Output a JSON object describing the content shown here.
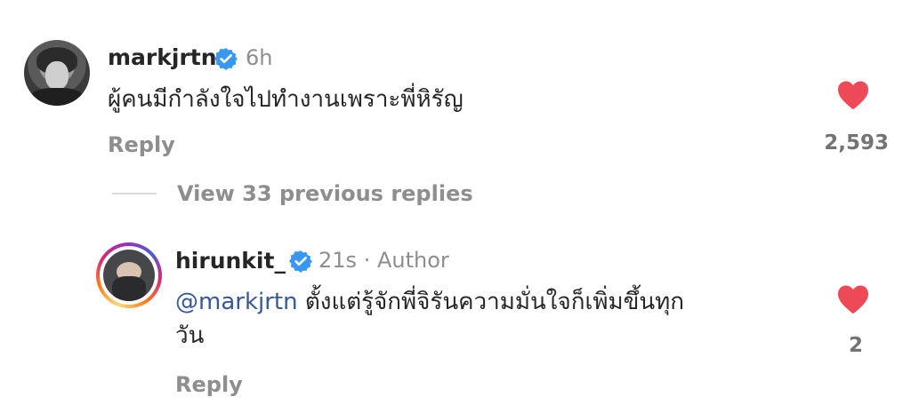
{
  "parent_comment": {
    "username": "markjrtn",
    "time": "6h",
    "text": "ผู้คนมีกำลังใจไปทำงานเพราะพี่หิรัญ",
    "reply_label": "Reply",
    "likes": "2,593",
    "like_icon": "heart-icon",
    "heart_color": "#ed4956",
    "verified_color": "#3897f0"
  },
  "view_replies": "View 33 previous replies",
  "reply_comment": {
    "username": "hirunkit_",
    "time": "21s",
    "separator": "·",
    "author_label": "Author",
    "mention": "@markjrtn",
    "text_line1": "ตั้งแต่รู้จักพี่จิรันความมั่นใจก็เพิ่มขึ้นทุก",
    "text_line2": "วัน",
    "reply_label": "Reply",
    "likes": "2",
    "like_icon": "heart-icon"
  }
}
